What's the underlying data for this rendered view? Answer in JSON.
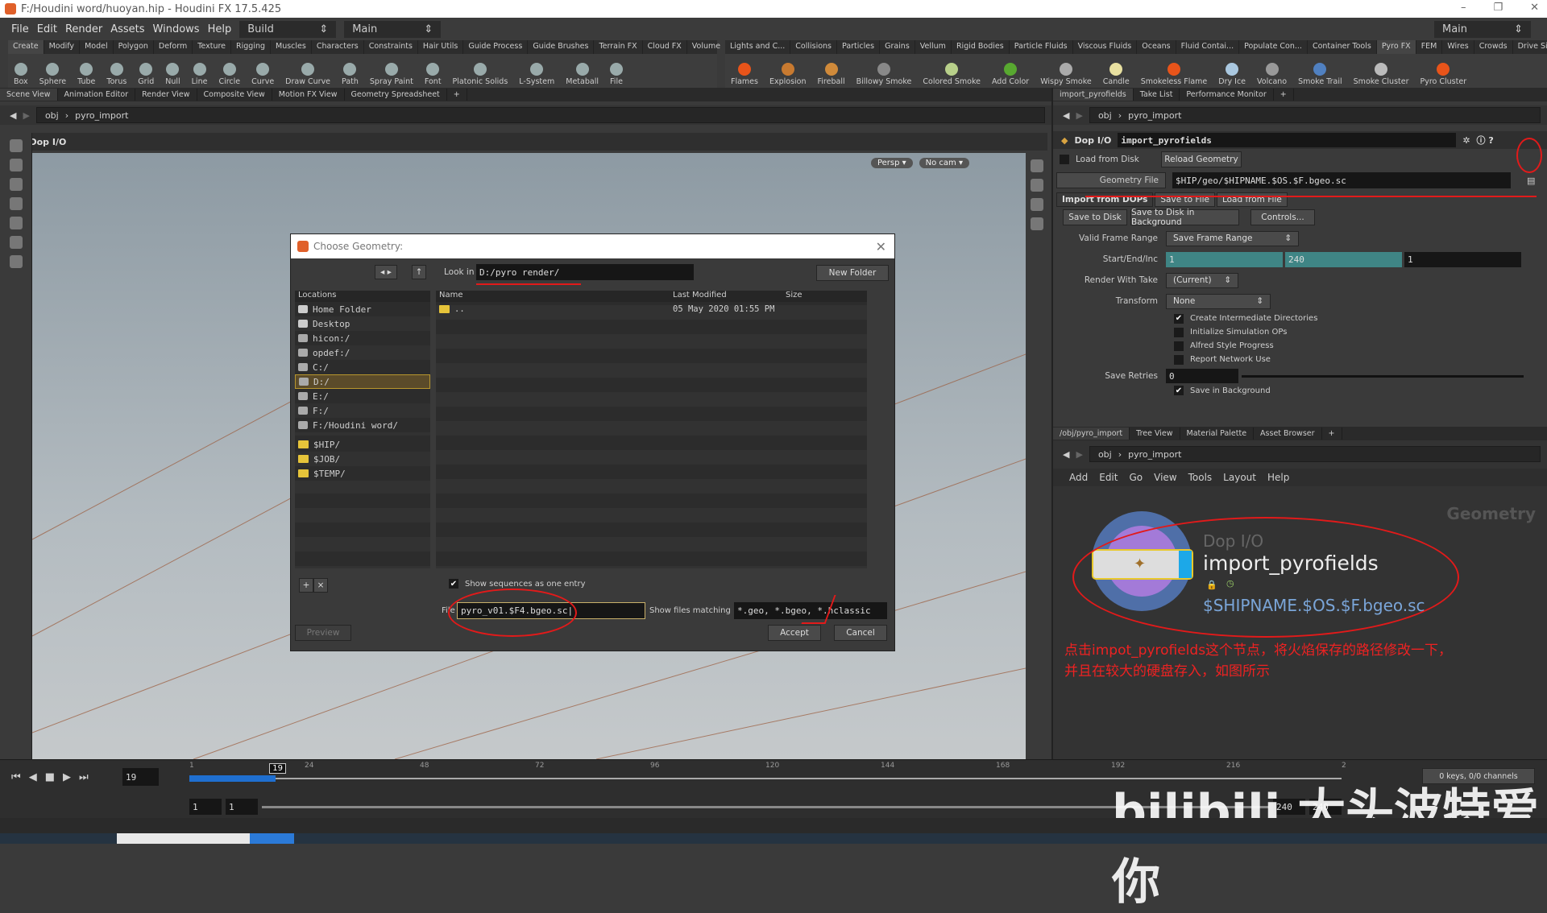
{
  "window": {
    "title": "F:/Houdini word/huoyan.hip - Houdini FX 17.5.425",
    "controls": [
      "–",
      "❐",
      "✕"
    ]
  },
  "menubar": {
    "items": [
      "File",
      "Edit",
      "Render",
      "Assets",
      "Windows",
      "Help"
    ],
    "desktop": "Build",
    "workspace": "Main",
    "right_workspace": "Main"
  },
  "shelf_left": {
    "tabs": [
      "Create",
      "Modify",
      "Model",
      "Polygon",
      "Deform",
      "Texture",
      "Rigging",
      "Muscles",
      "Characters",
      "Constraints",
      "Hair Utils",
      "Guide Process",
      "Guide Brushes",
      "Terrain FX",
      "Cloud FX",
      "Volume"
    ],
    "active": "Create",
    "tools": [
      "Box",
      "Sphere",
      "Tube",
      "Torus",
      "Grid",
      "Null",
      "Line",
      "Circle",
      "Curve",
      "Draw Curve",
      "Path",
      "Spray Paint",
      "Font",
      "Platonic Solids",
      "L-System",
      "Metaball",
      "File"
    ]
  },
  "shelf_right": {
    "tabs": [
      "Lights and C...",
      "Collisions",
      "Particles",
      "Grains",
      "Vellum",
      "Rigid Bodies",
      "Particle Fluids",
      "Viscous Fluids",
      "Oceans",
      "Fluid Contai...",
      "Populate Con...",
      "Container Tools",
      "Pyro FX",
      "FEM",
      "Wires",
      "Crowds",
      "Drive Simula..."
    ],
    "active": "Pyro FX",
    "tools": [
      "Flames",
      "Explosion",
      "Fireball",
      "Billowy Smoke",
      "Colored Smoke",
      "Add Color",
      "Wispy Smoke",
      "Candle",
      "Smokeless Flame",
      "Dry Ice",
      "Volcano",
      "Smoke Trail",
      "Smoke Cluster",
      "Pyro Cluster"
    ],
    "colors": {
      "Flames": "#e8541a",
      "Explosion": "#c87a30",
      "Fireball": "#d08a3a",
      "Billowy Smoke": "#888",
      "Colored Smoke": "#b8d08a",
      "Add Color": "#58a830",
      "Wispy Smoke": "#aaa",
      "Candle": "#e8e0a0",
      "Smokeless Flame": "#e8541a",
      "Dry Ice": "#aac8e0",
      "Volcano": "#999",
      "Smoke Trail": "#5080c0",
      "Smoke Cluster": "#bbb",
      "Pyro Cluster": "#e8541a"
    }
  },
  "scene_view": {
    "tabs": [
      "Scene View",
      "Animation Editor",
      "Render View",
      "Composite View",
      "Motion FX View",
      "Geometry Spreadsheet"
    ],
    "path": [
      "obj",
      "pyro_import"
    ],
    "header": "Dop I/O",
    "persp": "Persp ▾",
    "cam": "No cam ▾"
  },
  "dialog": {
    "title": "Choose Geometry:",
    "look_in_label": "Look in",
    "look_in": "D:/pyro render/",
    "new_folder": "New Folder",
    "locations_header": "Locations",
    "locations": [
      {
        "label": "Home Folder",
        "icon": "home-icon"
      },
      {
        "label": "Desktop",
        "icon": "desktop-icon"
      },
      {
        "label": "hicon:/",
        "icon": "drive-icon"
      },
      {
        "label": "opdef:/",
        "icon": "drive-icon"
      },
      {
        "label": "C:/",
        "icon": "drive-icon"
      },
      {
        "label": "D:/",
        "icon": "drive-icon",
        "selected": true
      },
      {
        "label": "E:/",
        "icon": "drive-icon"
      },
      {
        "label": "F:/",
        "icon": "drive-icon"
      },
      {
        "label": "F:/Houdini word/",
        "icon": "drive-icon"
      }
    ],
    "vars": [
      "$HIP/",
      "$JOB/",
      "$TEMP/"
    ],
    "columns": [
      "Name",
      "Last Modified",
      "Size"
    ],
    "files": [
      {
        "name": "..",
        "modified": "05 May 2020 01:55 PM",
        "size": ""
      }
    ],
    "show_sequences": "Show sequences as one entry",
    "file_label": "File",
    "file_value": "pyro_v01.$F4.bgeo.sc",
    "filter_label": "Show files matching",
    "filter_value": "*.geo, *.bgeo, *.hclassic",
    "preview": "Preview",
    "accept": "Accept",
    "cancel": "Cancel"
  },
  "params": {
    "tabs": [
      "import_pyrofields",
      "Take List",
      "Performance Monitor"
    ],
    "path": [
      "obj",
      "pyro_import"
    ],
    "node_type": "Dop I/O",
    "node_name": "import_pyrofields",
    "load_from_disk": "Load from Disk",
    "reload": "Reload Geometry",
    "geo_file_label": "Geometry File",
    "geo_file": "$HIP/geo/$HIPNAME.$OS.$F.bgeo.sc",
    "subtabs": [
      "Import from DOPs",
      "Save to File",
      "Load from File"
    ],
    "buttons": [
      "Save to Disk",
      "Save to Disk in Background",
      "Controls..."
    ],
    "valid_range_label": "Valid Frame Range",
    "valid_range": "Save Frame Range",
    "sei_label": "Start/End/Inc",
    "start": "1",
    "end": "240",
    "inc": "1",
    "take_label": "Render With Take",
    "take": "(Current)",
    "transform_label": "Transform",
    "transform": "None",
    "checks": [
      {
        "label": "Create Intermediate Directories",
        "checked": true
      },
      {
        "label": "Initialize Simulation OPs",
        "checked": false
      },
      {
        "label": "Alfred Style Progress",
        "checked": false
      },
      {
        "label": "Report Network Use",
        "checked": false
      }
    ],
    "retries_label": "Save Retries",
    "retries": "0",
    "save_bg": "Save in Background"
  },
  "network": {
    "tabs": [
      "/obj/pyro_import",
      "Tree View",
      "Material Palette",
      "Asset Browser"
    ],
    "path": [
      "obj",
      "pyro_import"
    ],
    "menu": [
      "Add",
      "Edit",
      "Go",
      "View",
      "Tools",
      "Layout",
      "Help"
    ],
    "context": "Geometry",
    "node_type": "Dop I/O",
    "node_name": "import_pyrofields",
    "node_file": "$SHIPNAME.$OS.$F.bgeo.sc",
    "annotation1": "点击impot_pyrofields这个节点，将火焰保存的路径修改一下，",
    "annotation2": "并且在较大的硬盘存入，如图所示"
  },
  "timeline": {
    "frame": "19",
    "ticks": [
      "1",
      "24",
      "48",
      "72",
      "96",
      "120",
      "144",
      "168",
      "192",
      "216",
      "2"
    ],
    "range_start": "1",
    "range_start2": "1",
    "range_end": "240",
    "range_end2": "240",
    "keys": "0 keys, 0/0 channels",
    "current_fraction": 0.075
  },
  "watermark": "bilibili 大头波特爱你"
}
